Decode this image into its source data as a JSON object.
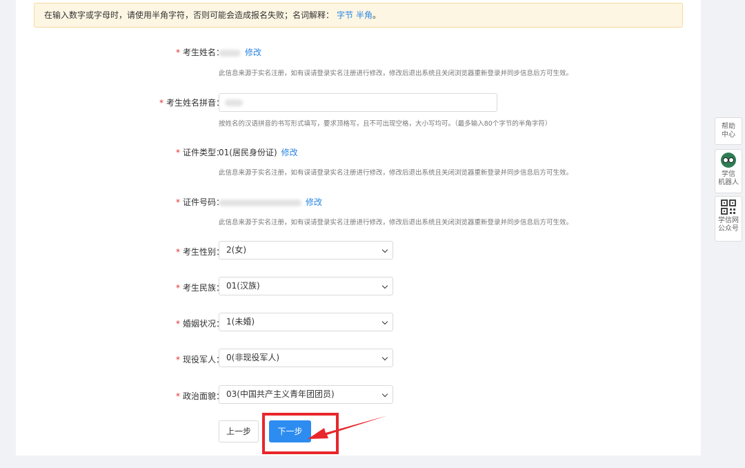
{
  "notice": {
    "text": "在输入数字或字母时，请使用半角字符，否则可能会造成报名失败；名词解释：",
    "links": [
      "字节",
      "半角"
    ],
    "end": "。"
  },
  "fields": {
    "name": {
      "label": "考生姓名：",
      "edit": "修改",
      "hint": "此信息来源于实名注册，如有误请登录实名注册进行修改，修改后退出系统且关闭浏览器重新登录并同步信息后方可生效。"
    },
    "pinyin": {
      "label": "考生姓名拼音：",
      "hint": "按姓名的汉语拼音的书写形式填写，要求顶格写，且不可出现空格，大小写均可。（最多输入80个字节的半角字符）"
    },
    "id_type": {
      "label": "证件类型：",
      "value": "01(居民身份证)",
      "edit": "修改",
      "hint": "此信息来源于实名注册，如有误请登录实名注册进行修改，修改后退出系统且关闭浏览器重新登录并同步信息后方可生效。"
    },
    "id_number": {
      "label": "证件号码：",
      "edit": "修改",
      "hint": "此信息来源于实名注册，如有误请登录实名注册进行修改，修改后退出系统且关闭浏览器重新登录并同步信息后方可生效。"
    },
    "gender": {
      "label": "考生性别：",
      "value": "2(女)"
    },
    "ethnicity": {
      "label": "考生民族：",
      "value": "01(汉族)"
    },
    "marital": {
      "label": "婚姻状况：",
      "value": "1(未婚)"
    },
    "military": {
      "label": "现役军人：",
      "value": "0(非现役军人)"
    },
    "political": {
      "label": "政治面貌：",
      "value": "03(中国共产主义青年团团员)"
    }
  },
  "required_mark": "*",
  "buttons": {
    "prev": "上一步",
    "next": "下一步"
  },
  "side": {
    "help": [
      "帮助",
      "中心"
    ],
    "robot": [
      "学信",
      "机器人"
    ],
    "qr": [
      "学信网",
      "公众号"
    ]
  },
  "colors": {
    "link": "#2b85e4",
    "primary": "#2d8cf0",
    "required": "#e0302d",
    "annotation": "#e8262b"
  }
}
